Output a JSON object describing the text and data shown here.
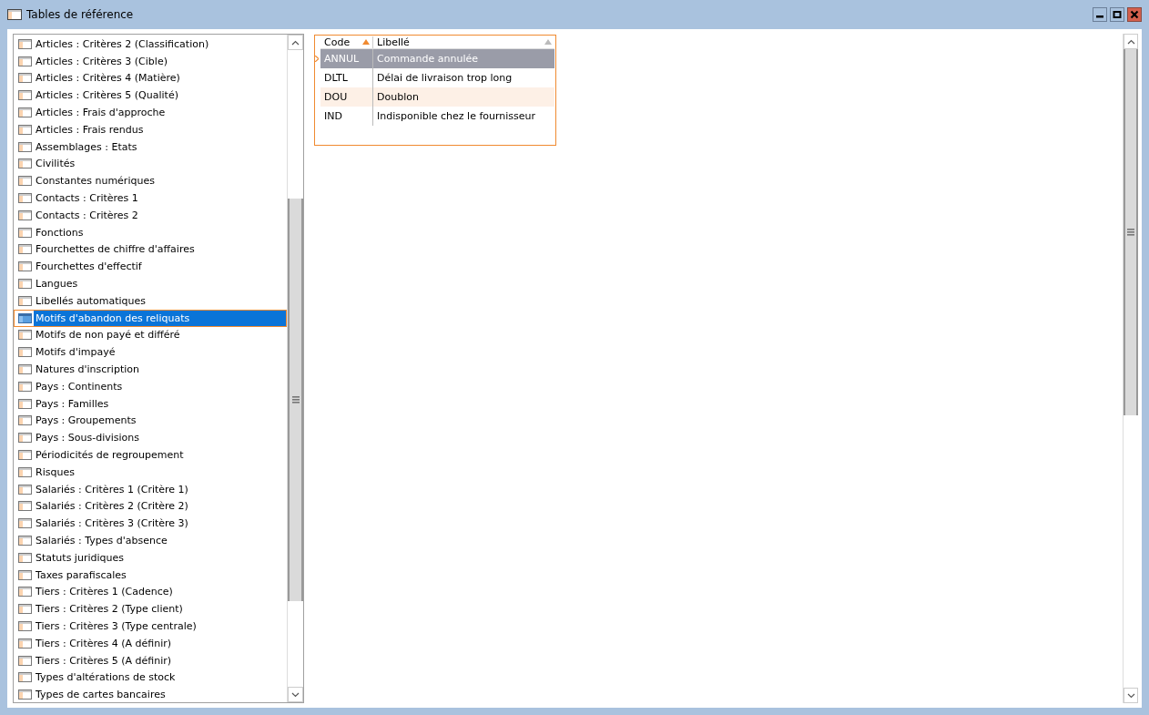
{
  "window": {
    "title": "Tables de référence"
  },
  "tables": [
    {
      "label": "Articles : Critères 2 (Classification)",
      "selected": false
    },
    {
      "label": "Articles : Critères 3 (Cible)",
      "selected": false
    },
    {
      "label": "Articles : Critères 4 (Matière)",
      "selected": false
    },
    {
      "label": "Articles : Critères 5 (Qualité)",
      "selected": false
    },
    {
      "label": "Articles : Frais d'approche",
      "selected": false
    },
    {
      "label": "Articles : Frais rendus",
      "selected": false
    },
    {
      "label": "Assemblages : Etats",
      "selected": false
    },
    {
      "label": "Civilités",
      "selected": false
    },
    {
      "label": "Constantes numériques",
      "selected": false
    },
    {
      "label": "Contacts : Critères 1",
      "selected": false
    },
    {
      "label": "Contacts : Critères 2",
      "selected": false
    },
    {
      "label": "Fonctions",
      "selected": false
    },
    {
      "label": "Fourchettes de chiffre d'affaires",
      "selected": false
    },
    {
      "label": "Fourchettes d'effectif",
      "selected": false
    },
    {
      "label": "Langues",
      "selected": false
    },
    {
      "label": "Libellés automatiques",
      "selected": false
    },
    {
      "label": "Motifs d'abandon des reliquats",
      "selected": true
    },
    {
      "label": "Motifs de non payé et différé",
      "selected": false
    },
    {
      "label": "Motifs d'impayé",
      "selected": false
    },
    {
      "label": "Natures d'inscription",
      "selected": false
    },
    {
      "label": "Pays : Continents",
      "selected": false
    },
    {
      "label": "Pays : Familles",
      "selected": false
    },
    {
      "label": "Pays : Groupements",
      "selected": false
    },
    {
      "label": "Pays : Sous-divisions",
      "selected": false
    },
    {
      "label": "Périodicités de regroupement",
      "selected": false
    },
    {
      "label": "Risques",
      "selected": false
    },
    {
      "label": "Salariés : Critères 1 (Critère 1)",
      "selected": false
    },
    {
      "label": "Salariés : Critères 2 (Critère 2)",
      "selected": false
    },
    {
      "label": "Salariés : Critères 3 (Critère 3)",
      "selected": false
    },
    {
      "label": "Salariés : Types d'absence",
      "selected": false
    },
    {
      "label": "Statuts juridiques",
      "selected": false
    },
    {
      "label": "Taxes parafiscales",
      "selected": false
    },
    {
      "label": "Tiers : Critères 1 (Cadence)",
      "selected": false
    },
    {
      "label": "Tiers : Critères 2 (Type client)",
      "selected": false
    },
    {
      "label": "Tiers : Critères 3 (Type centrale)",
      "selected": false
    },
    {
      "label": "Tiers : Critères 4 (A définir)",
      "selected": false
    },
    {
      "label": "Tiers : Critères 5 (A définir)",
      "selected": false
    },
    {
      "label": "Types d'altérations de stock",
      "selected": false
    },
    {
      "label": "Types de cartes bancaires",
      "selected": false
    }
  ],
  "grid": {
    "columns": [
      {
        "label": "Code",
        "sort_active": true
      },
      {
        "label": "Libellé",
        "sort_active": false
      }
    ],
    "rows": [
      {
        "code": "ANNUL",
        "label": "Commande annulée",
        "selected": true
      },
      {
        "code": "DLTL",
        "label": "Délai de livraison trop long",
        "selected": false
      },
      {
        "code": "DOU",
        "label": "Doublon",
        "selected": false
      },
      {
        "code": "IND",
        "label": "Indisponible chez le fournisseur",
        "selected": false
      }
    ]
  }
}
